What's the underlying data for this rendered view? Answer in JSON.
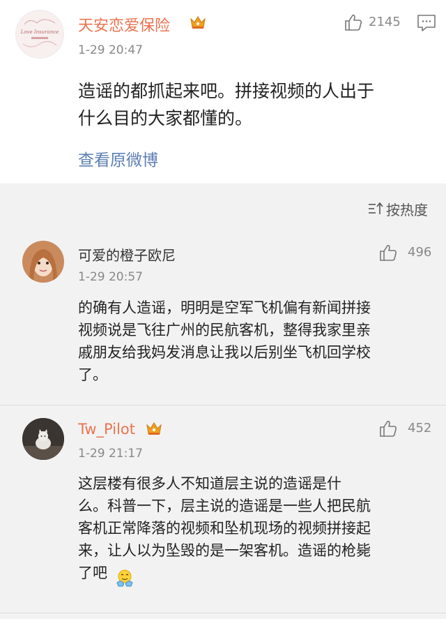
{
  "main_post": {
    "username": "天安恋爱保险",
    "time": "1-29 20:47",
    "like_count": "2145",
    "text": "造谣的都抓起来吧。拼接视频的人出于\n什么目的大家都懂的。",
    "view_original": "查看原微博",
    "avatar_text": "Love Insurance"
  },
  "sort": {
    "label": "按热度"
  },
  "comments": [
    {
      "username": "可爱的橙子欧尼",
      "time": "1-29 20:57",
      "like_count": "496",
      "text": "的确有人造谣，明明是空军飞机偏有新闻拼接\n视频说是飞往广州的民航客机，整得我家里亲\n戚朋友给我妈发消息让我以后别坐飞机回学校\n了。"
    },
    {
      "username": "Tw_Pilot",
      "time": "1-29 21:17",
      "like_count": "452",
      "text": "这层楼有很多人不知道层主说的造谣是什\n么。科普一下，层主说的造谣是一些人把民航\n客机正常降落的视频和坠机现场的视频拼接起\n来，让人以为坠毁的是一架客机。造谣的枪毙\n了吧"
    }
  ],
  "colors": {
    "accent_orange": "#eb7350",
    "link_blue": "#5b7fb3",
    "crown_gold": "#f0a020",
    "page_bg": "#f2f2f2"
  },
  "icons": [
    "crown-icon",
    "thumbs-up-icon",
    "comment-icon",
    "sort-icon",
    "emoji-icon"
  ]
}
